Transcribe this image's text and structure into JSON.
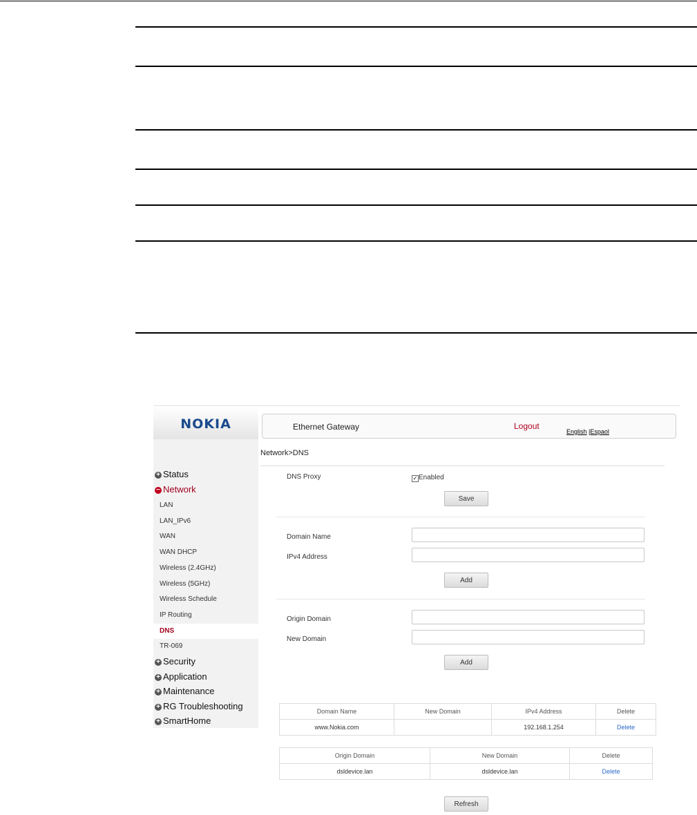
{
  "header": {
    "app_title": "Ethernet Gateway",
    "logout": "Logout",
    "lang_english": "English",
    "lang_sep": " |",
    "lang_espanol": "Espaol"
  },
  "logo": "NOKIA",
  "breadcrumb": "Network>DNS",
  "sidebar": {
    "status": "Status",
    "network": "Network",
    "sub": [
      "LAN",
      "LAN_IPv6",
      "WAN",
      "WAN DHCP",
      "Wireless (2.4GHz)",
      "Wireless (5GHz)",
      "Wireless Schedule",
      "IP Routing",
      "DNS",
      "TR-069"
    ],
    "security": "Security",
    "application": "Application",
    "maintenance": "Maintenance",
    "rg_troubleshooting": "RG Troubleshooting",
    "smarthome": "SmartHome"
  },
  "form": {
    "dns_proxy_label": "DNS Proxy",
    "dns_proxy_value": "Enabled",
    "dns_proxy_checked": true,
    "save": "Save",
    "domain_name_label": "Domain Name",
    "ipv4_label": "IPv4 Address",
    "add1": "Add",
    "origin_domain_label": "Origin Domain",
    "new_domain_label": "New Domain",
    "add2": "Add",
    "refresh": "Refresh"
  },
  "table1": {
    "headers": [
      "Domain Name",
      "New Domain",
      "IPv4 Address",
      "Delete"
    ],
    "row": [
      "www.Nokia.com",
      "",
      "192.168.1.254",
      "Delete"
    ]
  },
  "table2": {
    "headers": [
      "Origin Domain",
      "New Domain",
      "Delete"
    ],
    "row": [
      "dsldevice.lan",
      "dsldevice.lan",
      "Delete"
    ]
  },
  "colors": {
    "brand": "#1a4a8c",
    "active": "#a0001e",
    "link": "#2a6ac8"
  }
}
